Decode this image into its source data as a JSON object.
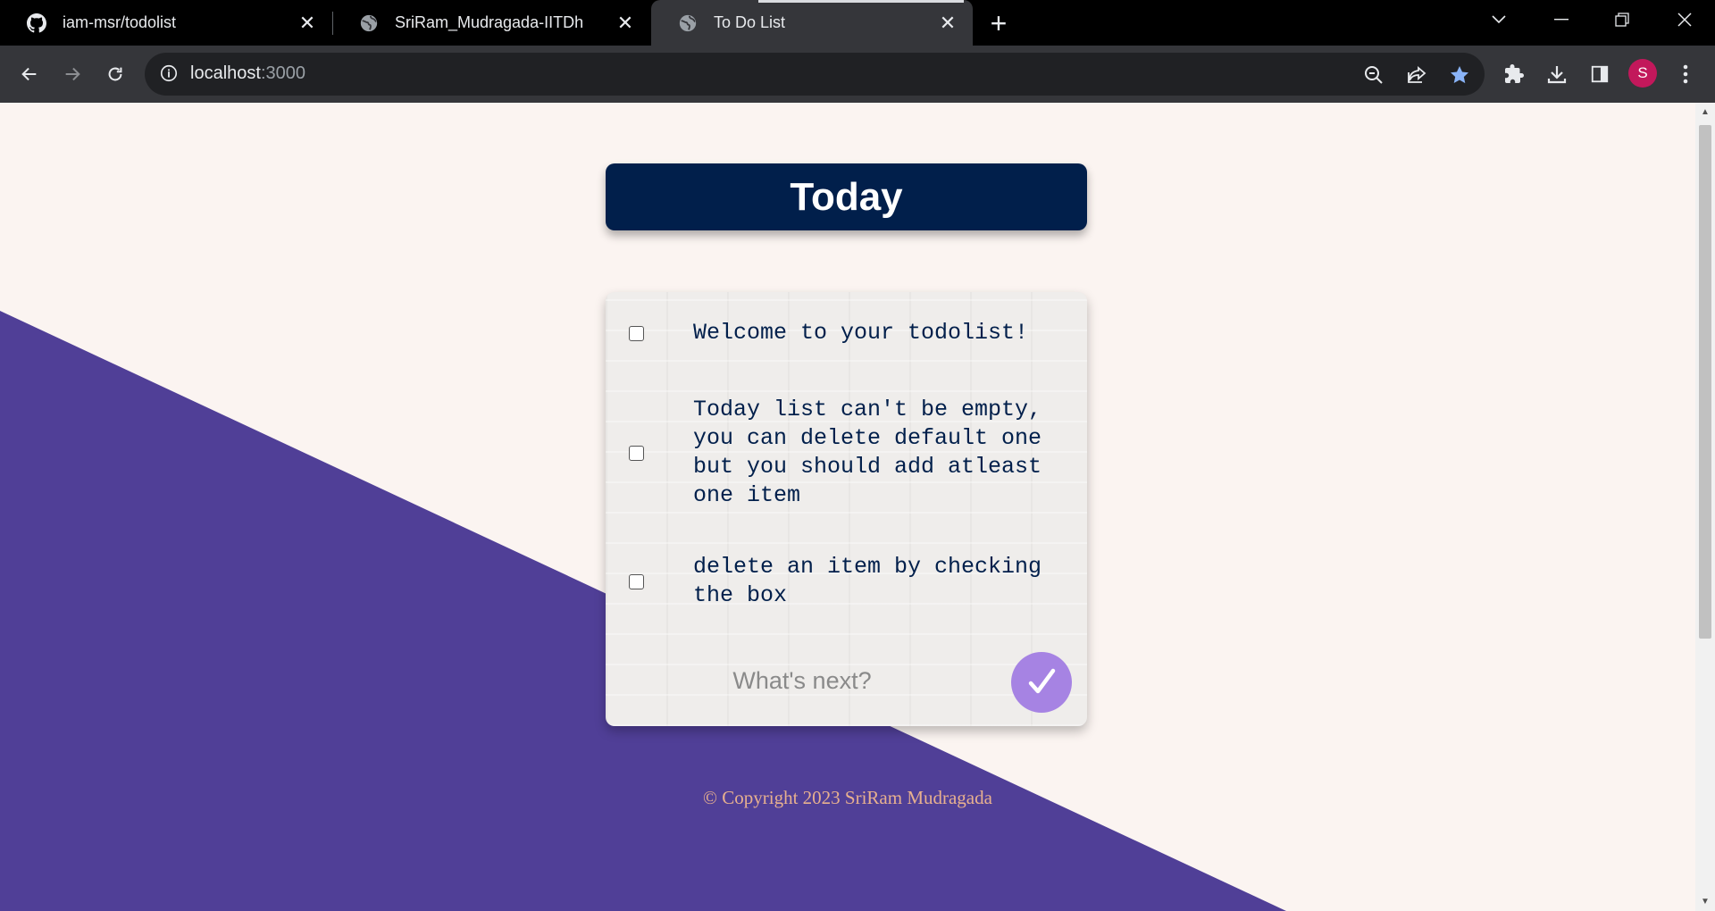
{
  "browser": {
    "tabs": [
      {
        "title": "iam-msr/todolist",
        "icon": "github-icon"
      },
      {
        "title": "SriRam_Mudragada-IITDh",
        "icon": "globe-icon"
      },
      {
        "title": "To Do List",
        "icon": "globe-icon",
        "active": true
      }
    ],
    "url_host": "localhost",
    "url_port": ":3000",
    "profile_initial": "S",
    "colors": {
      "profile": "#c2185b",
      "bookmark_star": "#8ab4f8"
    }
  },
  "page": {
    "heading": "Today",
    "items": [
      {
        "text": "Welcome to your todolist!",
        "checked": false
      },
      {
        "text": "Today list can't be empty, you can delete default one but you should add atleast one item",
        "checked": false
      },
      {
        "text": "delete an item by checking the box",
        "checked": false
      }
    ],
    "new_item_placeholder": "What's next?",
    "submit_icon": "checkmark-icon",
    "footer": "© Copyright 2023 SriRam Mudragada",
    "colors": {
      "background": "#fbf4f1",
      "diagonal": "#503f97",
      "heading_bg": "#011f4b",
      "heading_text": "#ffffff",
      "item_text": "#011f4b",
      "submit_button": "#a683e3",
      "footer_text": "#e7b08f"
    }
  }
}
